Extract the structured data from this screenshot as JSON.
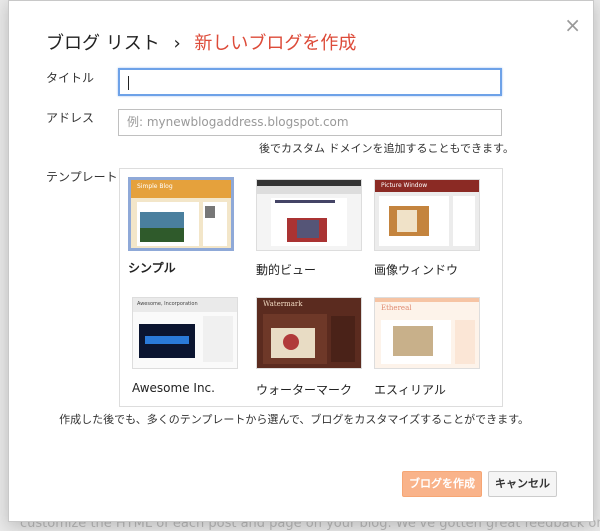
{
  "dialog": {
    "close_glyph": "×",
    "breadcrumb": {
      "root": "ブログ リスト",
      "separator": "›",
      "current": "新しいブログを作成"
    },
    "title_label": "タイトル",
    "title_value": "",
    "address_label": "アドレス",
    "address_placeholder": "例: mynewblogaddress.blogspot.com",
    "address_hint": "後でカスタム ドメインを追加することもできます。",
    "template_label": "テンプレート",
    "templates": [
      {
        "name": "シンプル",
        "thumb_title": "Simple Blog",
        "selected": true
      },
      {
        "name": "動的ビュー",
        "selected": false
      },
      {
        "name": "画像ウィンドウ",
        "thumb_title": "Picture Window",
        "selected": false
      },
      {
        "name": "Awesome Inc.",
        "thumb_title": "Awesome, Incorporation",
        "selected": false
      },
      {
        "name": "ウォーターマーク",
        "thumb_title": "Watermark",
        "selected": false
      },
      {
        "name": "エスィリアル",
        "thumb_title": "Ethereal",
        "selected": false
      }
    ],
    "note": "作成した後でも、多くのテンプレートから選んで、ブログをカスタマイズすることができます。",
    "create_button": "ブログを作成",
    "cancel_button": "キャンセル"
  },
  "background": {
    "visible_text": "customize the HTML of each post and page on your blog. We've gotten great feedback on them, so"
  },
  "colors": {
    "accent": "#dd4b39",
    "create_button_bg": "#f9b38a",
    "focus_border": "#6ea2e8",
    "selected_border": "#8fa9d8"
  }
}
